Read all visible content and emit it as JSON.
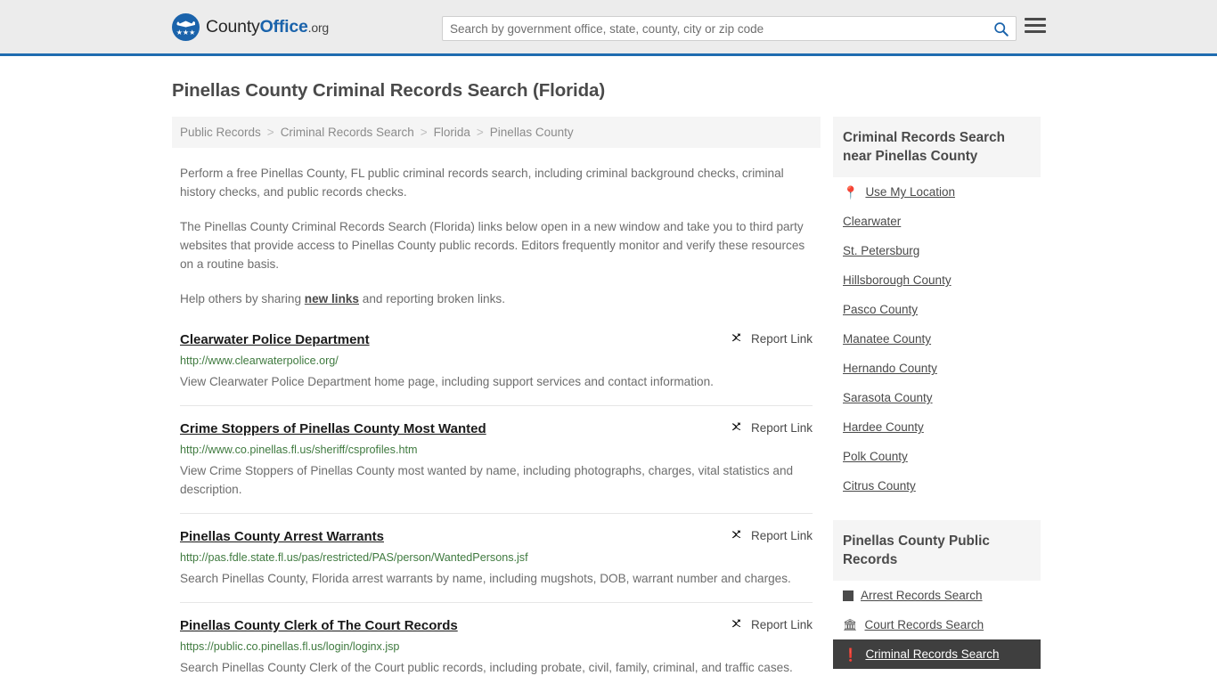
{
  "header": {
    "brand": {
      "part1": "County",
      "part2": "Office",
      "part3": ".org"
    },
    "search": {
      "placeholder": "Search by government office, state, county, city or zip code",
      "value": "",
      "search_icon": "search-icon"
    },
    "menu_icon": "hamburger-menu-icon"
  },
  "page_title": "Pinellas County Criminal Records Search (Florida)",
  "breadcrumb": {
    "items": [
      "Public Records",
      "Criminal Records Search",
      "Florida",
      "Pinellas County"
    ],
    "separator": ">"
  },
  "intro": {
    "p1": "Perform a free Pinellas County, FL public criminal records search, including criminal background checks, criminal history checks, and public records checks.",
    "p2": "The Pinellas County Criminal Records Search (Florida) links below open in a new window and take you to third party websites that provide access to Pinellas County public records. Editors frequently monitor and verify these resources on a routine basis.",
    "p3_before": "Help others by sharing ",
    "p3_link": "new links",
    "p3_after": " and reporting broken links."
  },
  "report_link_label": "Report Link",
  "report_link_icon": "broken-link-icon",
  "results": [
    {
      "title": "Clearwater Police Department",
      "url": "http://www.clearwaterpolice.org/",
      "description": "View Clearwater Police Department home page, including support services and contact information."
    },
    {
      "title": "Crime Stoppers of Pinellas County Most Wanted",
      "url": "http://www.co.pinellas.fl.us/sheriff/csprofiles.htm",
      "description": "View Crime Stoppers of Pinellas County most wanted by name, including photographs, charges, vital statistics and description."
    },
    {
      "title": "Pinellas County Arrest Warrants",
      "url": "http://pas.fdle.state.fl.us/pas/restricted/PAS/person/WantedPersons.jsf",
      "description": "Search Pinellas County, Florida arrest warrants by name, including mugshots, DOB, warrant number and charges."
    },
    {
      "title": "Pinellas County Clerk of The Court Records",
      "url": "https://public.co.pinellas.fl.us/login/loginx.jsp",
      "description": "Search Pinellas County Clerk of the Court public records, including probate, civil, family, criminal, and traffic cases."
    }
  ],
  "sidebar": {
    "nearby": {
      "heading": "Criminal Records Search near Pinellas County",
      "items": [
        {
          "label": "Use My Location",
          "icon": "map-pin-icon"
        },
        {
          "label": "Clearwater",
          "icon": ""
        },
        {
          "label": "St. Petersburg",
          "icon": ""
        },
        {
          "label": "Hillsborough County",
          "icon": ""
        },
        {
          "label": "Pasco County",
          "icon": ""
        },
        {
          "label": "Manatee County",
          "icon": ""
        },
        {
          "label": "Hernando County",
          "icon": ""
        },
        {
          "label": "Sarasota County",
          "icon": ""
        },
        {
          "label": "Hardee County",
          "icon": ""
        },
        {
          "label": "Polk County",
          "icon": ""
        },
        {
          "label": "Citrus County",
          "icon": ""
        }
      ]
    },
    "public_records": {
      "heading": "Pinellas County Public Records",
      "items": [
        {
          "label": "Arrest Records Search",
          "icon": "fingerprint-icon",
          "highlight": false
        },
        {
          "label": "Court Records Search",
          "icon": "courthouse-icon",
          "highlight": false
        },
        {
          "label": "Criminal Records Search",
          "icon": "flame-icon",
          "highlight": true
        }
      ]
    }
  },
  "colors": {
    "brand_blue": "#1a63ab",
    "header_border": "#1f6cb0",
    "url_green": "#3f7a3f",
    "highlight_bg": "#3f3f3f"
  }
}
